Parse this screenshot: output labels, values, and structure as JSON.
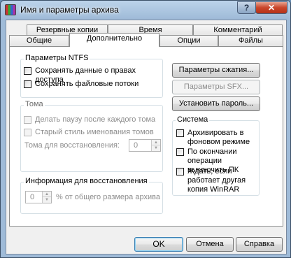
{
  "window": {
    "title": "Имя и параметры архива",
    "help_icon": "?",
    "close_icon": "✕"
  },
  "tabs": {
    "row1": [
      "Резервные копии",
      "Время",
      "Комментарий"
    ],
    "row2": [
      "Общие",
      "Дополнительно",
      "Опции",
      "Файлы"
    ],
    "active": "Дополнительно"
  },
  "ntfs": {
    "title": "Параметры NTFS",
    "save_security": "Сохранять данные о правах доступа",
    "save_streams": "Сохранять файловые потоки"
  },
  "volumes": {
    "title": "Тома",
    "pause_each": "Делать паузу после каждого тома",
    "old_naming": "Старый стиль именования томов",
    "recovery_volumes_label": "Тома для восстановления:",
    "recovery_volumes_value": "0"
  },
  "recovery": {
    "title": "Информация для восстановления",
    "value": "0",
    "suffix": "% от общего размера архива"
  },
  "buttons": {
    "compression": "Параметры сжатия...",
    "sfx": "Параметры SFX...",
    "password": "Установить пароль..."
  },
  "system": {
    "title": "Система",
    "background": "Архивировать в фоновом режиме",
    "shutdown": "По окончании операции выключить ПК",
    "wait": "Ждать, если работает другая копия WinRAR"
  },
  "footer": {
    "ok": "OK",
    "cancel": "Отмена",
    "help": "Справка"
  }
}
